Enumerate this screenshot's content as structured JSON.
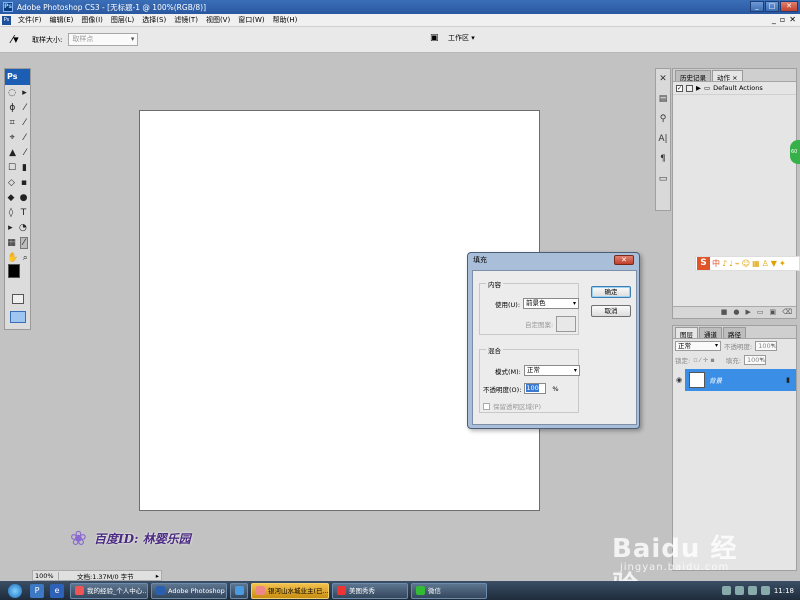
{
  "window": {
    "title": "Adobe Photoshop CS3 - [无标题-1 @ 100%(RGB/8)]",
    "controls": {
      "minimize": "_",
      "maximize": "□",
      "close": "✕"
    }
  },
  "menu": {
    "items": [
      "文件(F)",
      "编辑(E)",
      "图像(I)",
      "图层(L)",
      "选择(S)",
      "滤镜(T)",
      "视图(V)",
      "窗口(W)",
      "帮助(H)"
    ],
    "doc_controls": {
      "minimize": "_",
      "restore": "▫",
      "close": "✕"
    }
  },
  "options": {
    "sample_size_label": "取样大小:",
    "sample_size_value": "取样点",
    "workspace_label": "工作区 ▾"
  },
  "tools": {
    "logo": "Ps",
    "rows": [
      [
        "◌",
        "▸"
      ],
      [
        "ϕ",
        "⁄"
      ],
      [
        "⌗",
        "⁄"
      ],
      [
        "⌖",
        "⁄"
      ],
      [
        "▲",
        "⁄"
      ],
      [
        "☐",
        "▮"
      ],
      [
        "◇",
        "▪"
      ],
      [
        "◆",
        "●"
      ],
      [
        "◊",
        "T"
      ],
      [
        "▸",
        "◔"
      ],
      [
        "▦",
        "⁄"
      ],
      [
        "✋",
        "⌕"
      ]
    ]
  },
  "history_panel": {
    "tabs": [
      "历史记录",
      "动作 ×"
    ],
    "action_set": "Default Actions"
  },
  "layers_panel": {
    "tabs": [
      "图层",
      "通道",
      "路径"
    ],
    "blend_mode": "正常",
    "opacity_label": "不透明度:",
    "opacity_value": "100%",
    "lock_label": "锁定:",
    "fill_label": "填充:",
    "fill_value": "100%",
    "layer_name": "背景"
  },
  "ime_bar": {
    "logo": "S",
    "items": [
      "中",
      "♪",
      "♩",
      "⌁",
      "☺",
      "▦",
      "♙",
      "▼",
      "✦"
    ]
  },
  "green_widget": "60",
  "dialog": {
    "title": "填充",
    "close": "✕",
    "content_group": "内容",
    "use_label": "使用(U):",
    "use_value": "前景色",
    "custom_pattern_label": "自定图案:",
    "blend_group": "混合",
    "mode_label": "模式(M):",
    "mode_value": "正常",
    "opacity_label": "不透明度(O):",
    "opacity_value": "100",
    "opacity_unit": "%",
    "preserve_label": "保留透明区域(P)",
    "ok_label": "确定",
    "cancel_label": "取消"
  },
  "status": {
    "zoom": "100%",
    "doc_info": "文档:1.37M/0 字节"
  },
  "watermark": {
    "text": "百度ID: 林婴乐园"
  },
  "baidu_watermark": {
    "logo": "Baidu 经验",
    "url": "jingyan.baidu.com"
  },
  "taskbar": {
    "tasks": [
      "我的经验_个人中心...",
      "Adobe Photoshop ...",
      "",
      "银河山水城业主(已...",
      "美图秀秀",
      "微信"
    ],
    "active_index": 3,
    "clock": "11:18"
  }
}
